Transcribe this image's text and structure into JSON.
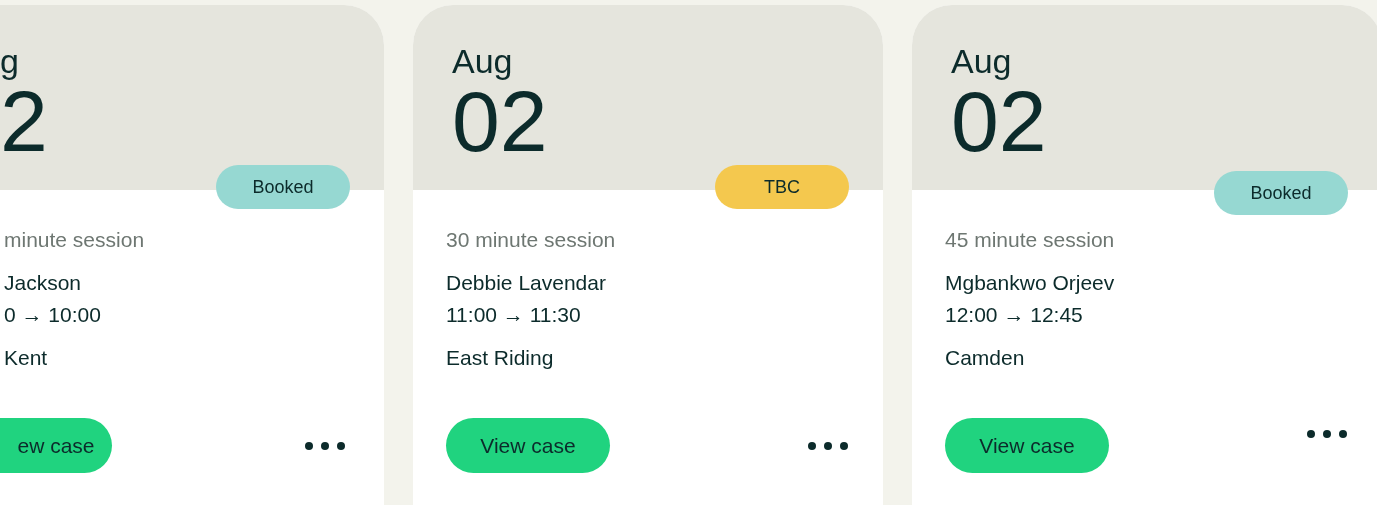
{
  "cards": [
    {
      "month": "g",
      "day": "2",
      "status": {
        "label": "Booked",
        "color": "#96d8d2"
      },
      "duration": "minute session",
      "name": "Jackson",
      "time": "0 → 10:00",
      "location": "Kent",
      "button": "ew case"
    },
    {
      "month": "Aug",
      "day": "02",
      "status": {
        "label": "TBC",
        "color": "#f4c84e"
      },
      "duration": "30 minute session",
      "name": "Debbie Lavendar",
      "time": "11:00 → 11:30",
      "location": "East Riding",
      "button": "View case"
    },
    {
      "month": "Aug",
      "day": "02",
      "status": {
        "label": "Booked",
        "color": "#96d8d2"
      },
      "duration": "45 minute session",
      "name": "Mgbankwo Orjeev",
      "time": "12:00 → 12:45",
      "location": "Camden",
      "button": "View case"
    }
  ]
}
